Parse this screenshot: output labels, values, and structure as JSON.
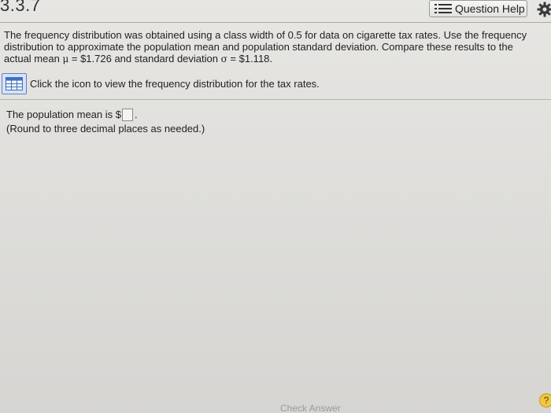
{
  "header": {
    "problem_number": "3.3.7",
    "help_label": "Question Help",
    "help_icon": "list-icon",
    "settings_icon": "gear-icon"
  },
  "question": {
    "line1": "The frequency distribution was obtained using a class width of 0.5 for data on cigarette tax rates. Use the frequency",
    "line2": "distribution to approximate the population mean and population standard deviation. Compare these results to the",
    "line3_prefix": "actual mean ",
    "mu_symbol": "μ",
    "mean_text": " = $1.726 and standard deviation ",
    "sigma_symbol": "σ",
    "sd_text": " = $1.118."
  },
  "icon_row": {
    "icon": "table-icon",
    "text": "Click the icon to view the frequency distribution for the tax rates."
  },
  "answer": {
    "prompt": "The population mean is $",
    "input_value": "",
    "period": ".",
    "note": "(Round to three decimal places as needed.)"
  },
  "footer": {
    "check_answer_label": "Check Answer",
    "help_circle_label": "?"
  },
  "colors": {
    "icon_border": "#5b84c9",
    "icon_fill": "#d7e2f4",
    "help_circle": "#f1c640"
  }
}
